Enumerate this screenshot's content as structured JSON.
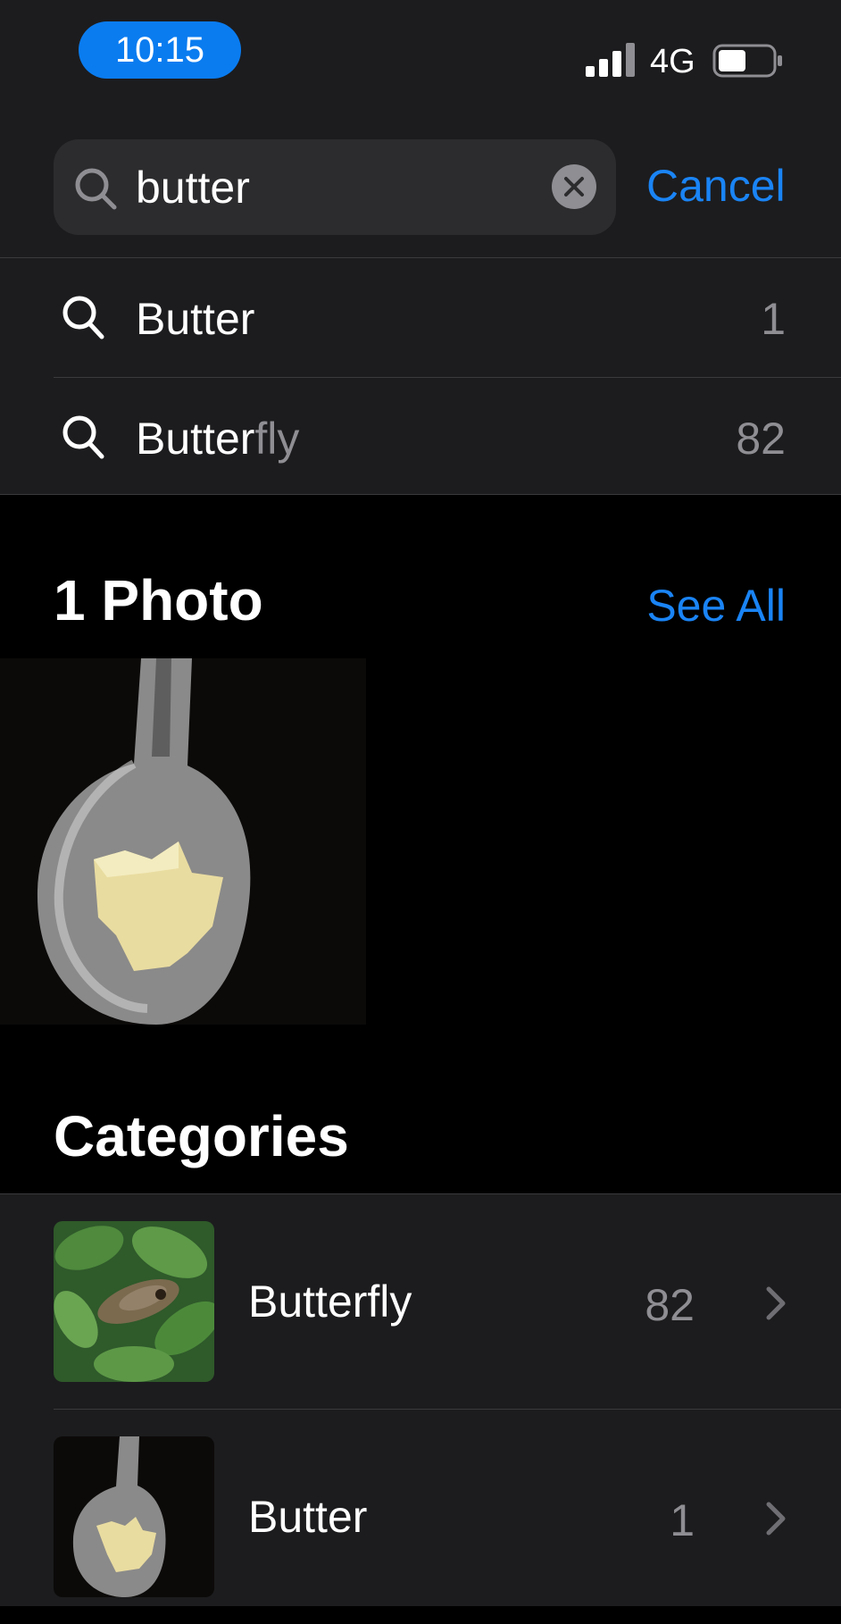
{
  "status_bar": {
    "time": "10:15",
    "network": "4G",
    "time_pill_color": "#0a7cf0"
  },
  "search": {
    "value": "butter",
    "cancel_label": "Cancel",
    "accent": "#1a84f5"
  },
  "suggestions": [
    {
      "matched": "Butter",
      "rest": "",
      "count": "1",
      "icon": "search-icon"
    },
    {
      "matched": "Butter",
      "rest": "fly",
      "count": "82",
      "icon": "search-icon"
    }
  ],
  "photos": {
    "title": "1 Photo",
    "see_all_label": "See All"
  },
  "categories": {
    "title": "Categories",
    "items": [
      {
        "label": "Butterfly",
        "count": "82",
        "icon": "chevron-right-icon"
      },
      {
        "label": "Butter",
        "count": "1",
        "icon": "chevron-right-icon"
      }
    ]
  }
}
